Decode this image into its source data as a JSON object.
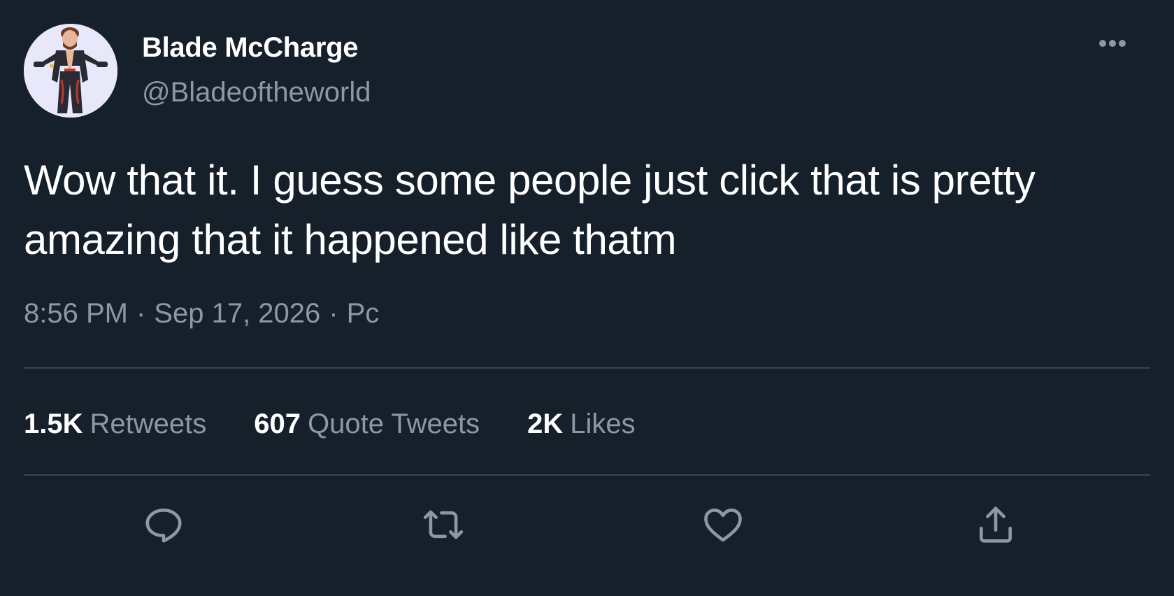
{
  "author": {
    "display_name": "Blade McCharge",
    "handle": "@Bladeoftheworld",
    "avatar": "avatar-image"
  },
  "tweet": {
    "text": "Wow that it. I guess some people just click that is pretty amazing that it happened like thatm",
    "time": "8:56 PM",
    "date": "Sep 17, 2026",
    "source": "Pc",
    "separator": "·"
  },
  "stats": {
    "retweets": {
      "count": "1.5K",
      "label": "Retweets"
    },
    "quote_tweets": {
      "count": "607",
      "label": "Quote Tweets"
    },
    "likes": {
      "count": "2K",
      "label": "Likes"
    }
  },
  "actions": [
    {
      "icon": "reply-icon"
    },
    {
      "icon": "retweet-icon"
    },
    {
      "icon": "like-icon"
    },
    {
      "icon": "share-icon"
    }
  ],
  "menu": {
    "icon": "more-options-icon"
  },
  "colors": {
    "background": "#15202b",
    "primary_text": "#ffffff",
    "secondary_text": "#8b98a5",
    "divider": "#38444d"
  }
}
